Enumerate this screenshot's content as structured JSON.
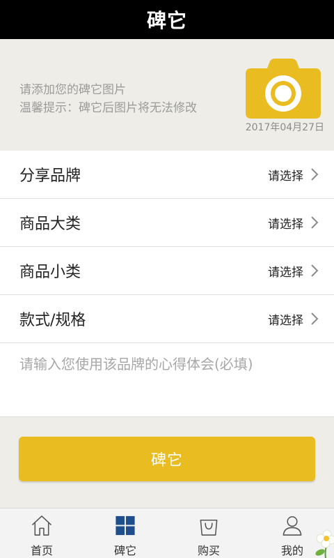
{
  "header": {
    "title": "碑它"
  },
  "photo": {
    "hint_line1": "请添加您的碑它图片",
    "hint_line2": "温馨提示：碑它后图片将无法修改",
    "date": "2017年04月27日",
    "camera_icon": "camera-icon"
  },
  "form": {
    "rows": [
      {
        "label": "分享品牌",
        "value": "请选择"
      },
      {
        "label": "商品大类",
        "value": "请选择"
      },
      {
        "label": "商品小类",
        "value": "请选择"
      },
      {
        "label": "款式/规格",
        "value": "请选择"
      }
    ],
    "comment_placeholder": "请输入您使用该品牌的心得体会(必填)"
  },
  "submit_label": "碑它",
  "tabs": [
    {
      "label": "首页",
      "icon": "home-icon"
    },
    {
      "label": "碑它",
      "icon": "grid-icon"
    },
    {
      "label": "购买",
      "icon": "shopping-bag-icon"
    },
    {
      "label": "我的",
      "icon": "user-icon"
    }
  ],
  "colors": {
    "accent": "#e9bc22",
    "titlebar": "#000000",
    "active_tab": "#1e4f8c"
  }
}
